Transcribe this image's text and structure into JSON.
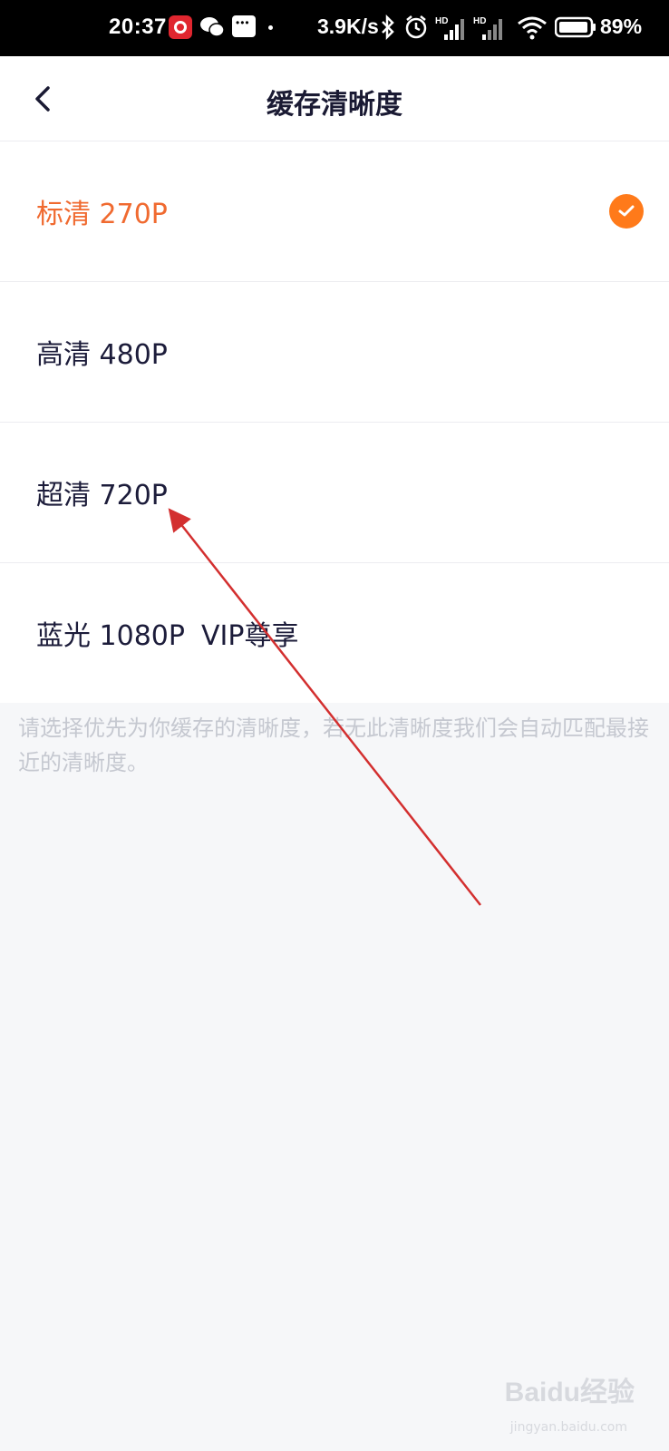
{
  "status_bar": {
    "time": "20:37",
    "speed": "3.9K/s",
    "battery": "89%",
    "icons": [
      "netease-music-icon",
      "wechat-icon",
      "message-icon",
      "bluetooth-icon",
      "alarm-icon",
      "signal-hd-icon",
      "signal-hd-icon",
      "wifi-icon",
      "battery-icon"
    ]
  },
  "header": {
    "back_icon": "chevron-left-icon",
    "title": "缓存清晰度"
  },
  "options": [
    {
      "label": "标清 270P",
      "selected": true
    },
    {
      "label": "高清 480P",
      "selected": false
    },
    {
      "label": "超清 720P",
      "selected": false
    },
    {
      "label": "蓝光 1080P",
      "tag": "VIP尊享",
      "selected": false
    }
  ],
  "hint_text": "请选择优先为你缓存的清晰度，若无此清晰度我们会自动匹配最接近的清晰度。",
  "watermark": {
    "main": "Baidu经验",
    "sub": "jingyan.baidu.com"
  },
  "colors": {
    "accent": "#f06a30",
    "check": "#ff7a1a",
    "annotation_arrow": "#d32f2f"
  }
}
